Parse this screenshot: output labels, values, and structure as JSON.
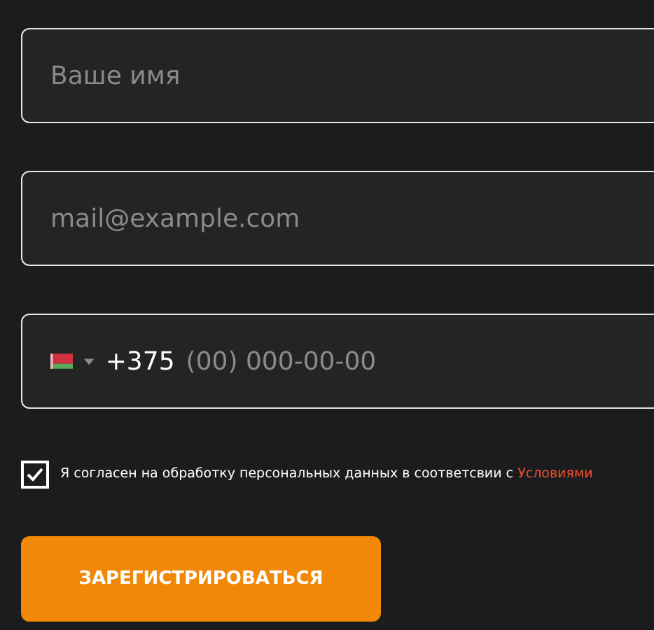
{
  "name_field": {
    "placeholder": "Ваше имя"
  },
  "email_field": {
    "placeholder": "mail@example.com"
  },
  "phone_field": {
    "country_code": "+375",
    "placeholder": "(00) 000-00-00"
  },
  "consent": {
    "checked": true,
    "text": "Я согласен на обработку персональных данных в соответсвии с",
    "link": "Условиями"
  },
  "submit_button": {
    "label": "ЗАРЕГИСТРИРОВАТЬСЯ"
  }
}
